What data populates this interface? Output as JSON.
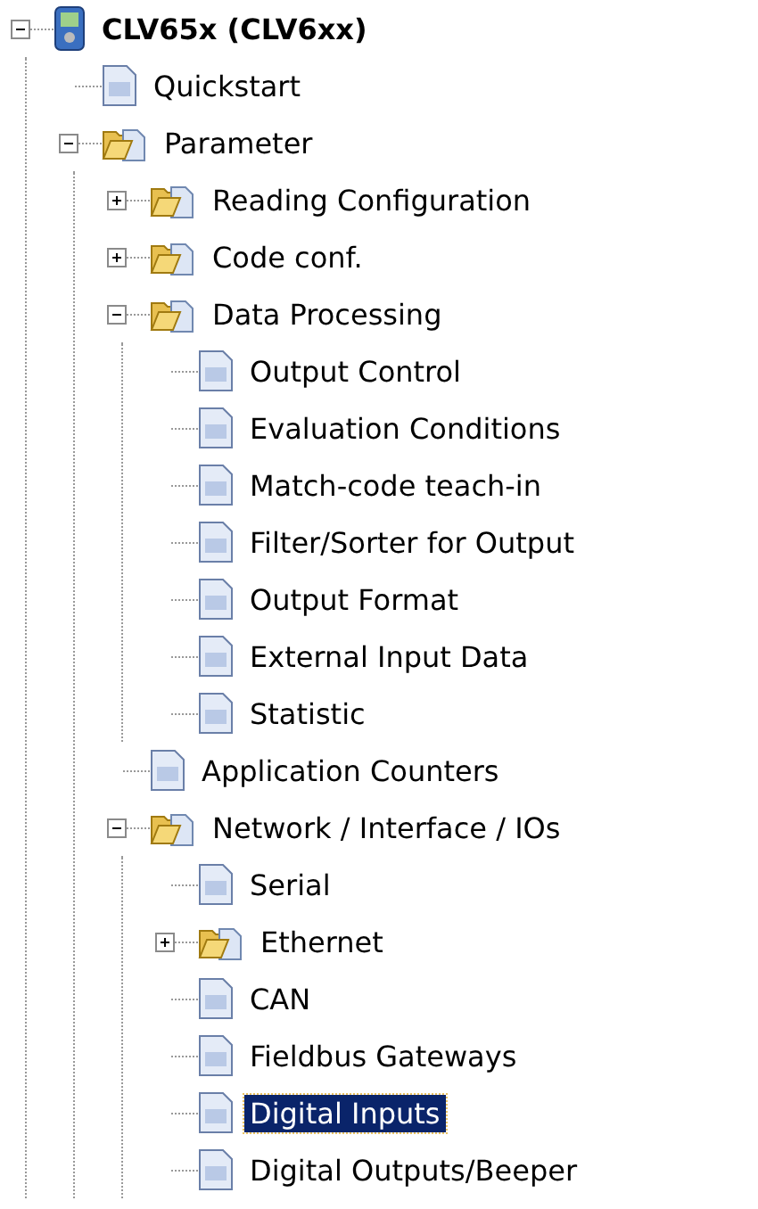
{
  "tree": [
    {
      "label": "CLV65x (CLV6xx)",
      "kind": "device",
      "expanded": true,
      "selected": false,
      "children": [
        {
          "label": "Quickstart",
          "kind": "page",
          "selected": false
        },
        {
          "label": "Parameter",
          "kind": "folder",
          "expanded": true,
          "selected": false,
          "children": [
            {
              "label": "Reading Configuration",
              "kind": "folder",
              "expanded": false,
              "selected": false
            },
            {
              "label": "Code conf.",
              "kind": "folder",
              "expanded": false,
              "selected": false
            },
            {
              "label": "Data Processing",
              "kind": "folder",
              "expanded": true,
              "selected": false,
              "children": [
                {
                  "label": "Output Control",
                  "kind": "page",
                  "selected": false
                },
                {
                  "label": "Evaluation Conditions",
                  "kind": "page",
                  "selected": false
                },
                {
                  "label": "Match-code teach-in",
                  "kind": "page",
                  "selected": false
                },
                {
                  "label": "Filter/Sorter for Output",
                  "kind": "page",
                  "selected": false
                },
                {
                  "label": "Output Format",
                  "kind": "page",
                  "selected": false
                },
                {
                  "label": "External Input Data",
                  "kind": "page",
                  "selected": false
                },
                {
                  "label": "Statistic",
                  "kind": "page",
                  "selected": false
                }
              ]
            },
            {
              "label": "Application Counters",
              "kind": "page",
              "selected": false
            },
            {
              "label": "Network / Interface / IOs",
              "kind": "folder",
              "expanded": true,
              "selected": false,
              "children": [
                {
                  "label": "Serial",
                  "kind": "page",
                  "selected": false
                },
                {
                  "label": "Ethernet",
                  "kind": "folder",
                  "expanded": false,
                  "selected": false
                },
                {
                  "label": "CAN",
                  "kind": "page",
                  "selected": false
                },
                {
                  "label": "Fieldbus Gateways",
                  "kind": "page",
                  "selected": false
                },
                {
                  "label": "Digital Inputs",
                  "kind": "page",
                  "selected": true
                },
                {
                  "label": "Digital Outputs/Beeper",
                  "kind": "page",
                  "selected": false
                }
              ]
            }
          ]
        }
      ]
    }
  ]
}
